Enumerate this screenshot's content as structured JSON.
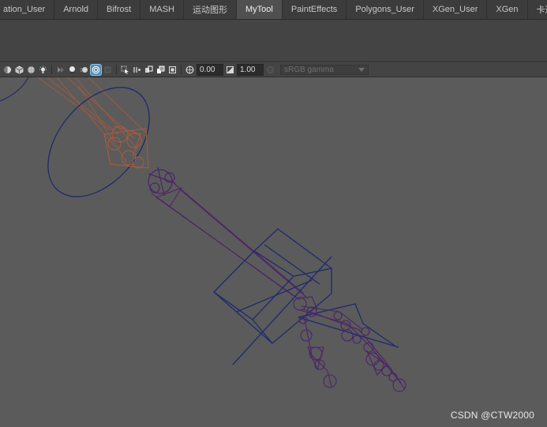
{
  "shelf": {
    "tabs": [
      {
        "label": "ation_User",
        "active": false
      },
      {
        "label": "Arnold",
        "active": false
      },
      {
        "label": "Bifrost",
        "active": false
      },
      {
        "label": "MASH",
        "active": false
      },
      {
        "label": "运动图形",
        "active": false
      },
      {
        "label": "MyTool",
        "active": true
      },
      {
        "label": "PaintEffects",
        "active": false
      },
      {
        "label": "Polygons_User",
        "active": false
      },
      {
        "label": "XGen_User",
        "active": false
      },
      {
        "label": "XGen",
        "active": false
      },
      {
        "label": "卡通",
        "active": false
      }
    ]
  },
  "toolbar": {
    "exposure_value": "0.00",
    "gamma_value": "1.00",
    "color_space": "sRGB gamma"
  },
  "colors": {
    "background": "#5b5b5b",
    "wireframe_blue": "#1f2a6e",
    "wireframe_purple": "#4a2468",
    "wireframe_orange": "#b05a3a",
    "active_icon": "#5a8fb3"
  },
  "watermark": "CSDN @CTW2000"
}
